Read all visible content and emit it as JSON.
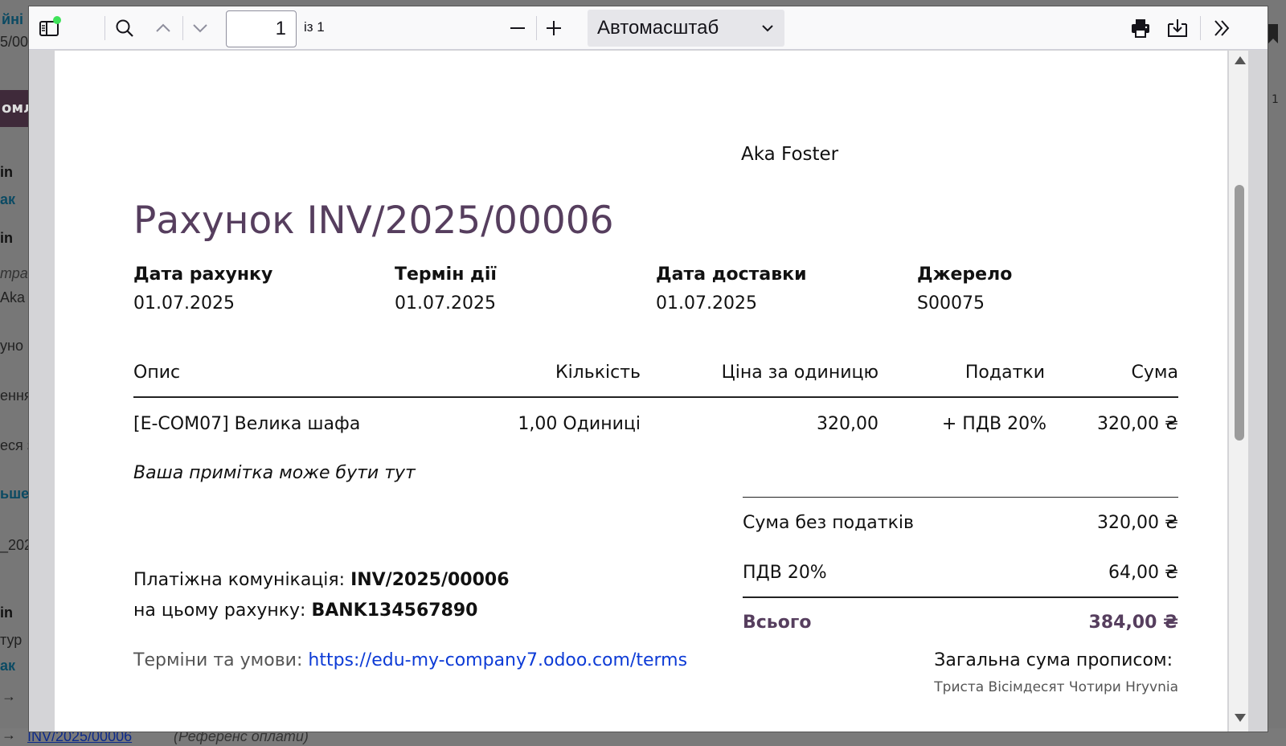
{
  "background": {
    "fragments": [
      "йні",
      "5/00",
      "омл",
      "in",
      "ак",
      "in",
      "тра",
      "Aka",
      "уно",
      "ення",
      "еся з",
      "ьше",
      "_202",
      "in",
      "тур",
      "ак",
      "→"
    ],
    "bottom_link": "INV/2025/00006",
    "bottom_note": "(Референс оплати)",
    "right_num": "1"
  },
  "toolbar": {
    "page_number": "1",
    "page_count": "із 1",
    "zoom": "Автомасштаб"
  },
  "invoice": {
    "partner": "Aka Foster",
    "title": "Рахунок INV/2025/00006",
    "info": [
      {
        "label": "Дата рахунку",
        "value": "01.07.2025"
      },
      {
        "label": "Термін дії",
        "value": "01.07.2025"
      },
      {
        "label": "Дата доставки",
        "value": "01.07.2025"
      },
      {
        "label": "Джерело",
        "value": "S00075"
      }
    ],
    "columns": {
      "description": "Опис",
      "quantity": "Кількість",
      "unit_price": "Ціна за одиницю",
      "taxes": "Податки",
      "amount": "Сума"
    },
    "lines": [
      {
        "description": "[E-COM07] Велика шафа",
        "quantity": "1,00 Одиниці",
        "unit_price": "320,00",
        "taxes": "+ ПДВ 20%",
        "amount": "320,00 ₴"
      }
    ],
    "note": "Ваша примітка може бути тут",
    "totals": {
      "untaxed_label": "Сума без податків",
      "untaxed_value": "320,00 ₴",
      "tax_label": "ПДВ 20%",
      "tax_value": "64,00 ₴",
      "total_label": "Всього",
      "total_value": "384,00 ₴"
    },
    "payment": {
      "comm_label": "Платіжна комунікація:",
      "comm_value": "INV/2025/00006",
      "account_label": "на цьому рахунку:",
      "account_value": "BANK134567890"
    },
    "terms_label": "Терміни та умови:",
    "terms_link": "https://edu-my-company7.odoo.com/terms",
    "amount_words_label": "Загальна сума прописом:",
    "amount_words": "Триста Вісімдесят Чотири Hryvnia"
  }
}
